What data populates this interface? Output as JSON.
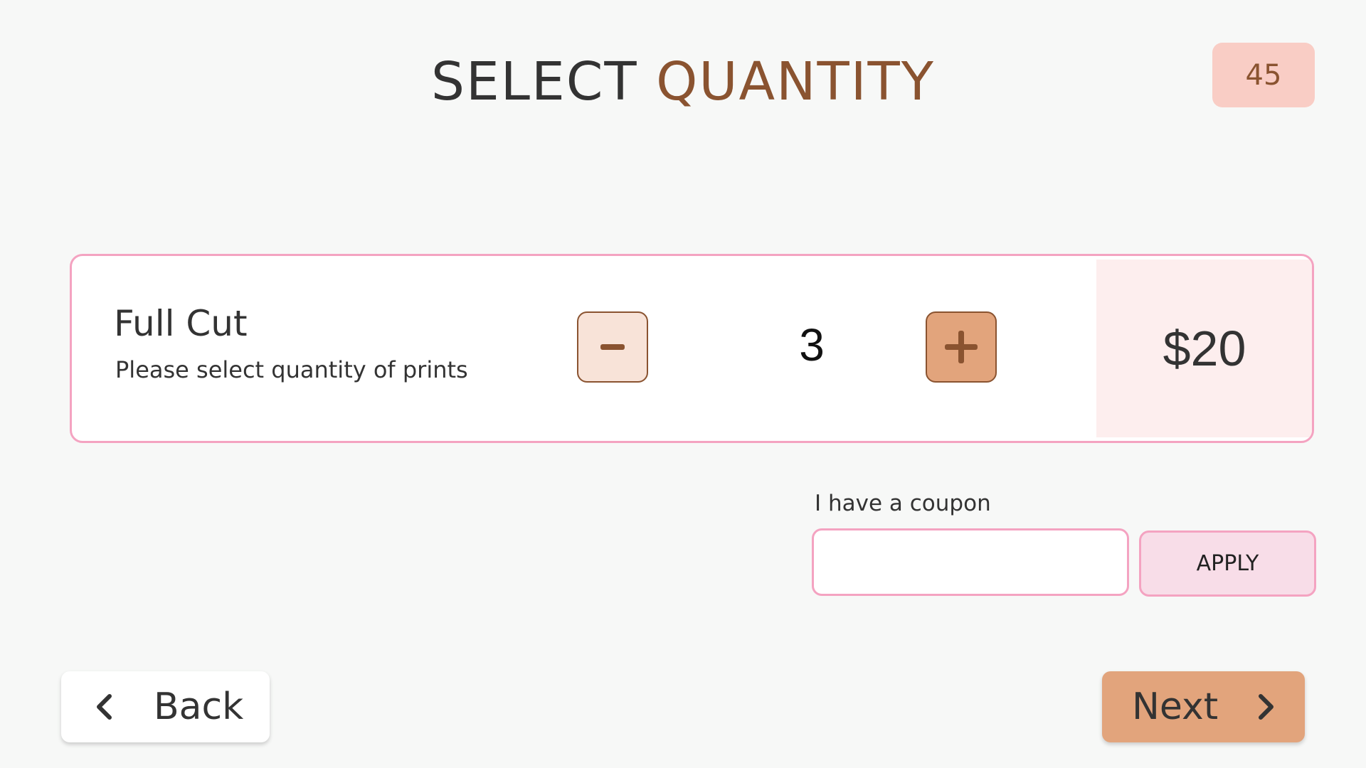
{
  "header": {
    "title_part1": "SELECT",
    "title_part2": "QUANTITY",
    "timer": "45"
  },
  "product": {
    "name": "Full Cut",
    "description": "Please select quantity of prints",
    "quantity": "3",
    "price": "$20",
    "minus_icon": "minus-icon",
    "plus_icon": "plus-icon"
  },
  "coupon": {
    "label": "I have a coupon",
    "value": "",
    "placeholder": "",
    "apply_label": "APPLY"
  },
  "nav": {
    "back_label": "Back",
    "next_label": "Next",
    "back_icon": "chevron-left-icon",
    "next_icon": "chevron-right-icon"
  },
  "colors": {
    "background": "#f7f8f7",
    "accent_brown": "#8a5330",
    "accent_tan": "#e2a47c",
    "pink_border": "#f4a3c1",
    "badge_bg": "#f9cdc5",
    "price_bg": "#fdeeee",
    "apply_bg": "#f8dde8"
  }
}
